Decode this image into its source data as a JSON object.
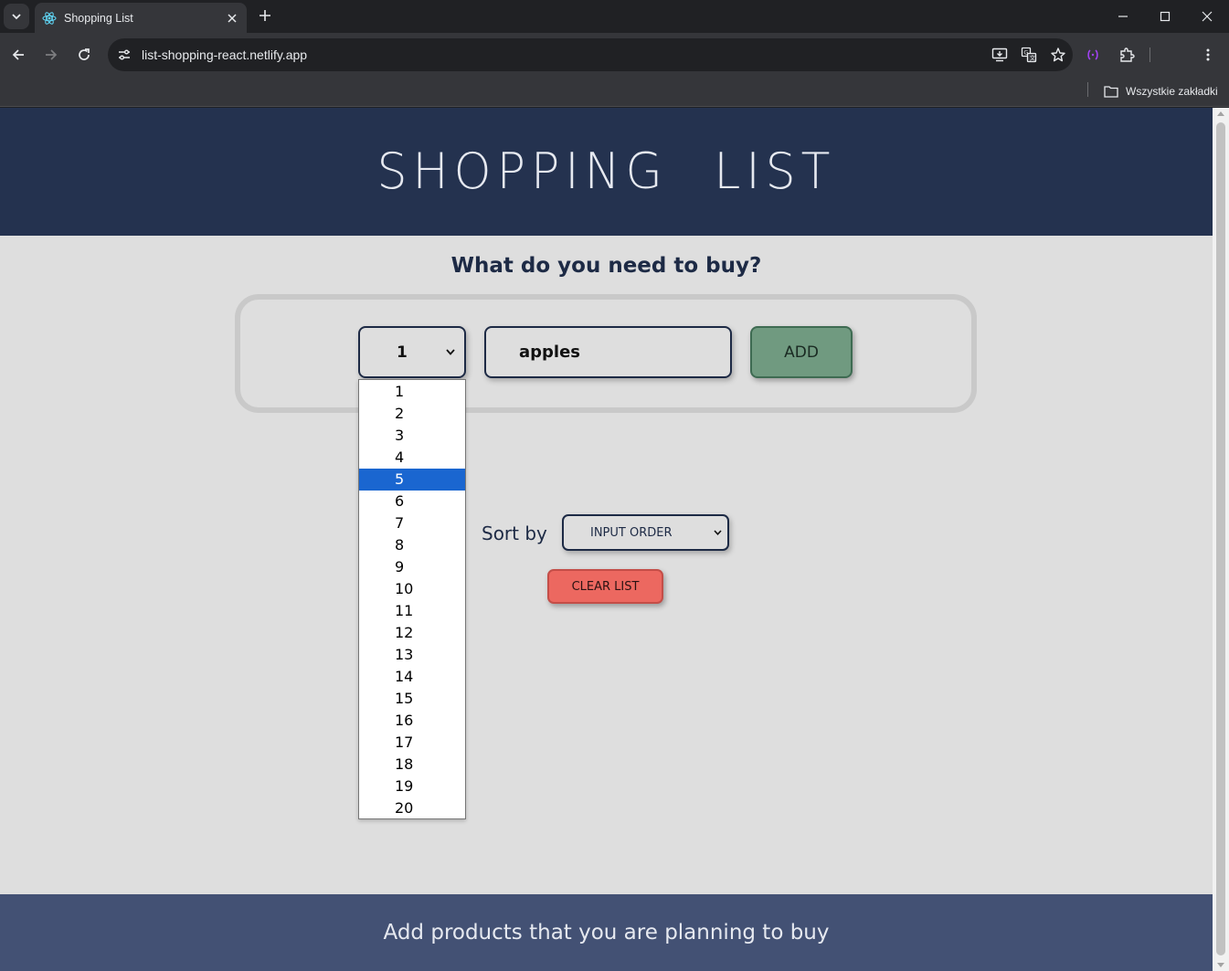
{
  "browser": {
    "tab": {
      "title": "Shopping List"
    },
    "url": "list-shopping-react.netlify.app",
    "bookmarks_bar": {
      "all_bookmarks_label": "Wszystkie zakładki"
    },
    "colors": {
      "frame": "#202124",
      "toolbar": "#35363a"
    }
  },
  "page": {
    "header": {
      "title": "Shopping List"
    },
    "form": {
      "question": "What do you need to buy?",
      "quantity": {
        "selected": "1",
        "highlighted_option": "5",
        "options": [
          "1",
          "2",
          "3",
          "4",
          "5",
          "6",
          "7",
          "8",
          "9",
          "10",
          "11",
          "12",
          "13",
          "14",
          "15",
          "16",
          "17",
          "18",
          "19",
          "20"
        ]
      },
      "item_input": {
        "value": "apples"
      },
      "add_button": "ADD"
    },
    "sort": {
      "label": "Sort by",
      "selected": "INPUT ORDER"
    },
    "clear_button": "CLEAR LIST",
    "footer": {
      "text": "Add products that you are planning to buy"
    },
    "colors": {
      "header_bg": "#24324f",
      "page_bg": "#dedede",
      "add_button": "#709a80",
      "clear_button": "#ec6860",
      "footer_bg": "#435174",
      "dropdown_highlight": "#1a66d0"
    }
  }
}
